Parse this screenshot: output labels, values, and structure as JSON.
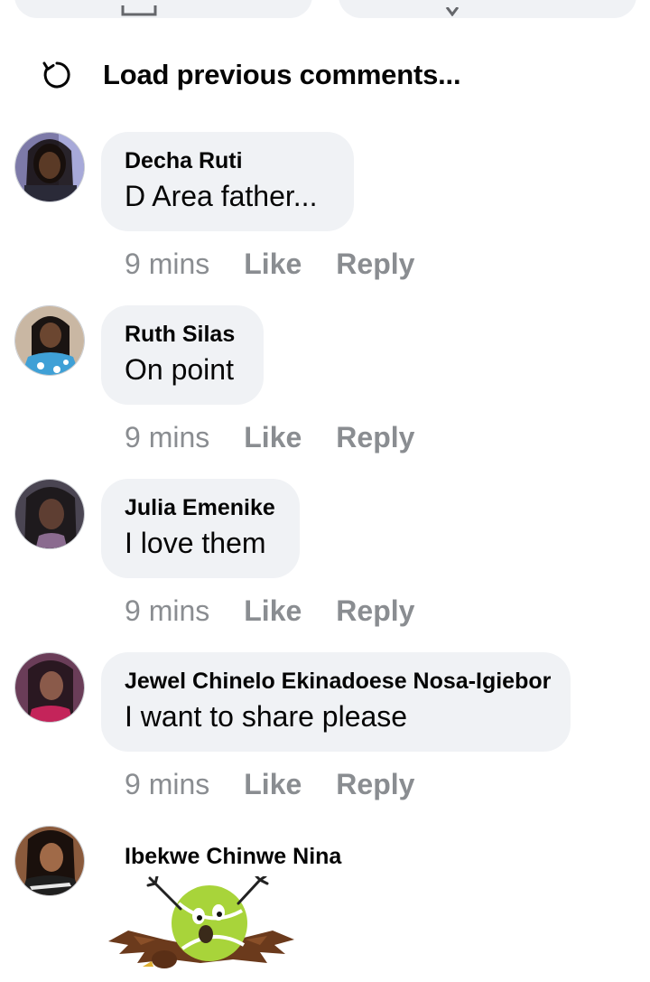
{
  "load_previous": {
    "label": "Load previous comments..."
  },
  "comments": [
    {
      "name": "Decha Ruti",
      "text": "D Area father...",
      "time": "9 mins",
      "like": "Like",
      "reply": "Reply"
    },
    {
      "name": "Ruth Silas",
      "text": "On point",
      "time": "9 mins",
      "like": "Like",
      "reply": "Reply"
    },
    {
      "name": "Julia Emenike",
      "text": "I love them",
      "time": "9 mins",
      "like": "Like",
      "reply": "Reply"
    },
    {
      "name": "Jewel Chinelo Ekinadoese Nosa-Igiebor",
      "text": "I want to share please",
      "time": "9 mins",
      "like": "Like",
      "reply": "Reply"
    }
  ],
  "last_comment": {
    "name": "Ibekwe Chinwe Nina",
    "attachment": "sticker-tennis-ball-eagle"
  },
  "colors": {
    "bubble": "#f0f2f5",
    "meta": "#8a8d91",
    "text": "#050505"
  }
}
